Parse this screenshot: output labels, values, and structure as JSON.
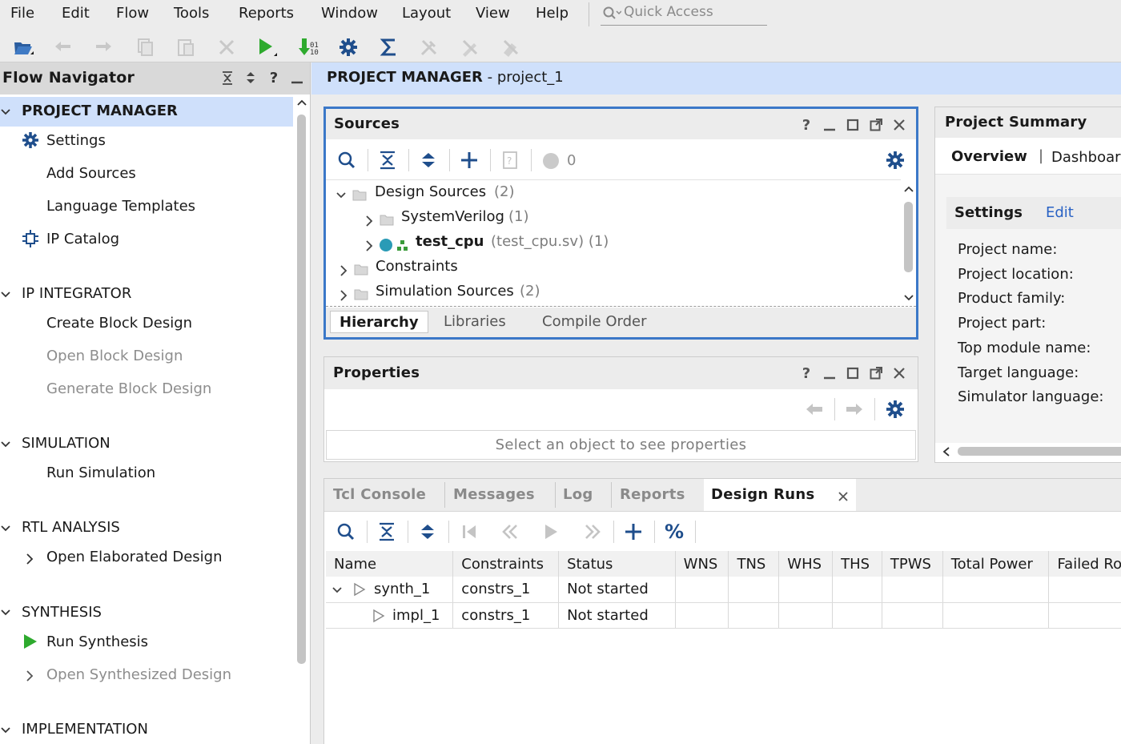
{
  "menu": {
    "file": "File",
    "edit": "Edit",
    "flow": "Flow",
    "tools": "Tools",
    "reports": "Reports",
    "window": "Window",
    "layout": "Layout",
    "view": "View",
    "help": "Help",
    "quick_access_placeholder": "Quick Access"
  },
  "flow_navigator": {
    "title": "Flow Navigator",
    "project_manager": "PROJECT MANAGER",
    "pm_items": [
      "Settings",
      "Add Sources",
      "Language Templates",
      "IP Catalog"
    ],
    "ip_integrator": "IP INTEGRATOR",
    "ipi_items": [
      "Create Block Design",
      "Open Block Design",
      "Generate Block Design"
    ],
    "simulation": "SIMULATION",
    "sim_items": [
      "Run Simulation"
    ],
    "rtl_analysis": "RTL ANALYSIS",
    "rtl_items": [
      "Open Elaborated Design"
    ],
    "synthesis": "SYNTHESIS",
    "synth_items": [
      "Run Synthesis",
      "Open Synthesized Design"
    ],
    "implementation": "IMPLEMENTATION"
  },
  "main_header": {
    "title": "PROJECT MANAGER",
    "project": " - project_1"
  },
  "sources": {
    "title": "Sources",
    "error_count": "0",
    "tree": {
      "design_sources": "Design Sources",
      "design_sources_count": "(2)",
      "systemverilog": "SystemVerilog",
      "systemverilog_count": "(1)",
      "top": "test_cpu",
      "top_file": "(test_cpu.sv) (1)",
      "constraints": "Constraints",
      "simulation_sources": "Simulation Sources",
      "simulation_sources_count": "(2)"
    },
    "tabs": [
      "Hierarchy",
      "Libraries",
      "Compile Order"
    ]
  },
  "properties": {
    "title": "Properties",
    "empty_msg": "Select an object to see properties"
  },
  "summary": {
    "title": "Project Summary",
    "tab_overview": "Overview",
    "tab_dashboard": "Dashboar",
    "settings_label": "Settings",
    "edit_link": "Edit",
    "fields": [
      "Project name:",
      "Project location:",
      "Product family:",
      "Project part:",
      "Top module name:",
      "Target language:",
      "Simulator language:"
    ]
  },
  "runs": {
    "tabs": [
      "Tcl Console",
      "Messages",
      "Log",
      "Reports",
      "Design Runs"
    ],
    "columns": [
      "Name",
      "Constraints",
      "Status",
      "WNS",
      "TNS",
      "WHS",
      "THS",
      "TPWS",
      "Total Power",
      "Failed Ro"
    ],
    "rows": [
      {
        "name": "synth_1",
        "constraints": "constrs_1",
        "status": "Not started"
      },
      {
        "name": "impl_1",
        "constraints": "constrs_1",
        "status": "Not started"
      }
    ]
  },
  "colors": {
    "accent_blue": "#3b78c8",
    "header_blue": "#cfe0fb",
    "run_green": "#2eaa2e",
    "icon_navy": "#1f4e8c"
  }
}
